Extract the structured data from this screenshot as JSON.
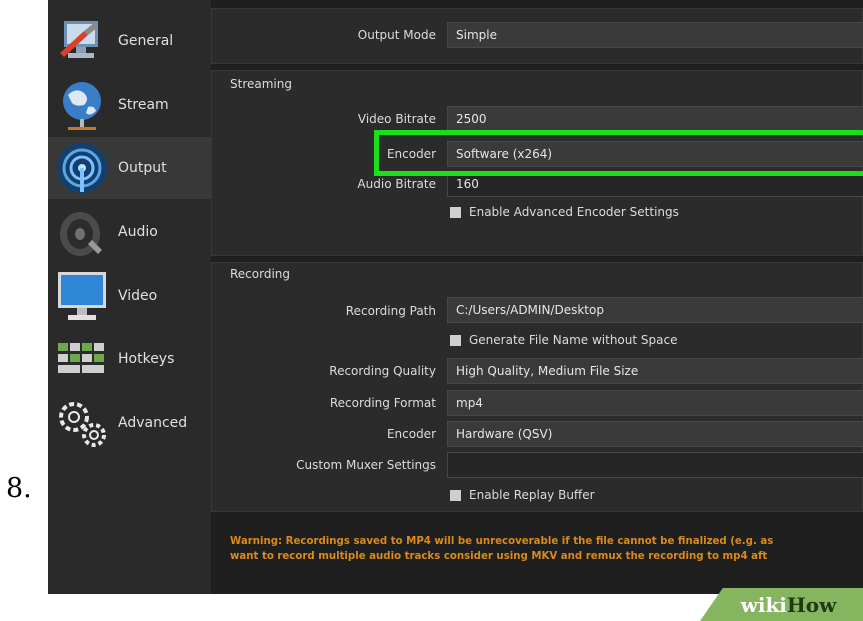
{
  "step_number": "8.",
  "sidebar": {
    "items": [
      {
        "label": "General",
        "icon": "general-icon"
      },
      {
        "label": "Stream",
        "icon": "stream-globe-icon"
      },
      {
        "label": "Output",
        "icon": "output-signal-icon",
        "active": true
      },
      {
        "label": "Audio",
        "icon": "speaker-icon"
      },
      {
        "label": "Video",
        "icon": "monitor-icon"
      },
      {
        "label": "Hotkeys",
        "icon": "keyboard-icon"
      },
      {
        "label": "Advanced",
        "icon": "gears-icon"
      }
    ]
  },
  "output": {
    "mode_label": "Output Mode",
    "mode_value": "Simple"
  },
  "streaming": {
    "title": "Streaming",
    "video_bitrate_label": "Video Bitrate",
    "video_bitrate_value": "2500",
    "encoder_label": "Encoder",
    "encoder_value": "Software (x264)",
    "audio_bitrate_label": "Audio Bitrate",
    "audio_bitrate_value": "160",
    "advanced_encoder_label": "Enable Advanced Encoder Settings"
  },
  "recording": {
    "title": "Recording",
    "path_label": "Recording Path",
    "path_value": "C:/Users/ADMIN/Desktop",
    "no_space_label": "Generate File Name without Space",
    "quality_label": "Recording Quality",
    "quality_value": "High Quality, Medium File Size",
    "format_label": "Recording Format",
    "format_value": "mp4",
    "encoder_label": "Encoder",
    "encoder_value": "Hardware (QSV)",
    "muxer_label": "Custom Muxer Settings",
    "muxer_value": "",
    "replay_label": "Enable Replay Buffer"
  },
  "warning": {
    "line1": "Warning: Recordings saved to MP4 will be unrecoverable if the file cannot be finalized (e.g. as",
    "line2": "want to record multiple audio tracks consider using MKV and remux the recording to mp4 aft"
  },
  "watermark": {
    "wiki": "wiki",
    "how": "How"
  },
  "colors": {
    "highlight": "#19e019",
    "warning": "#d98a1b",
    "watermark_bg": "#86b55f"
  }
}
